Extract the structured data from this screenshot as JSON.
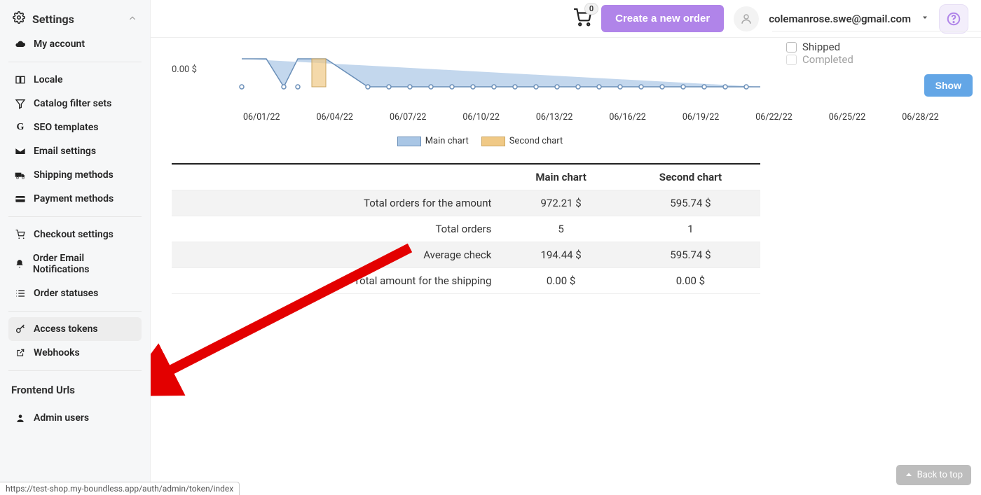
{
  "header": {
    "cart_count": "0",
    "create_order_label": "Create a new order",
    "user_email": "colemanrose.swe@gmail.com"
  },
  "sidebar": {
    "settings_label": "Settings",
    "items": [
      {
        "label": "My account",
        "icon": "cloud"
      },
      "divider",
      {
        "label": "Locale",
        "icon": "locale"
      },
      {
        "label": "Catalog filter sets",
        "icon": "filter"
      },
      {
        "label": "SEO templates",
        "icon": "seo"
      },
      {
        "label": "Email settings",
        "icon": "mail"
      },
      {
        "label": "Shipping methods",
        "icon": "truck"
      },
      {
        "label": "Payment methods",
        "icon": "card"
      },
      "divider",
      {
        "label": "Checkout settings",
        "icon": "cart"
      },
      {
        "label": "Order Email Notifications",
        "icon": "bell"
      },
      {
        "label": "Order statuses",
        "icon": "list"
      },
      "divider",
      {
        "label": "Access tokens",
        "icon": "key",
        "active": true
      },
      {
        "label": "Webhooks",
        "icon": "external"
      }
    ],
    "frontend_heading": "Frontend Urls",
    "admin_users_label": "Admin users"
  },
  "chart_data": {
    "type": "area",
    "title": "",
    "xlabel": "",
    "ylabel": "",
    "y_min_label": "0.00 $",
    "x_ticks": [
      "06/01/22",
      "06/04/22",
      "06/07/22",
      "06/10/22",
      "06/13/22",
      "06/16/22",
      "06/19/22",
      "06/22/22",
      "06/25/22",
      "06/28/22"
    ],
    "legend": [
      "Main chart",
      "Second chart"
    ],
    "series": [
      {
        "name": "Main chart",
        "color": "#a9c6e5"
      },
      {
        "name": "Second chart",
        "color": "#f0c986"
      }
    ],
    "note": "values are cropped above visible area; only baseline/drop-to-zero visible"
  },
  "table": {
    "headers": [
      "",
      "Main chart",
      "Second chart"
    ],
    "rows": [
      {
        "label": "Total orders for the amount",
        "main": "972.21 $",
        "second": "595.74 $"
      },
      {
        "label": "Total orders",
        "main": "5",
        "second": "1"
      },
      {
        "label": "Average check",
        "main": "194.44 $",
        "second": "595.74 $"
      },
      {
        "label": "Total amount for the shipping",
        "main": "0.00 $",
        "second": "0.00 $"
      }
    ]
  },
  "right_panel": {
    "shipped_label": "Shipped",
    "completed_label": "Completed",
    "show_label": "Show"
  },
  "back_to_top": "Back to top",
  "status_url": "https://test-shop.my-boundless.app/auth/admin/token/index"
}
